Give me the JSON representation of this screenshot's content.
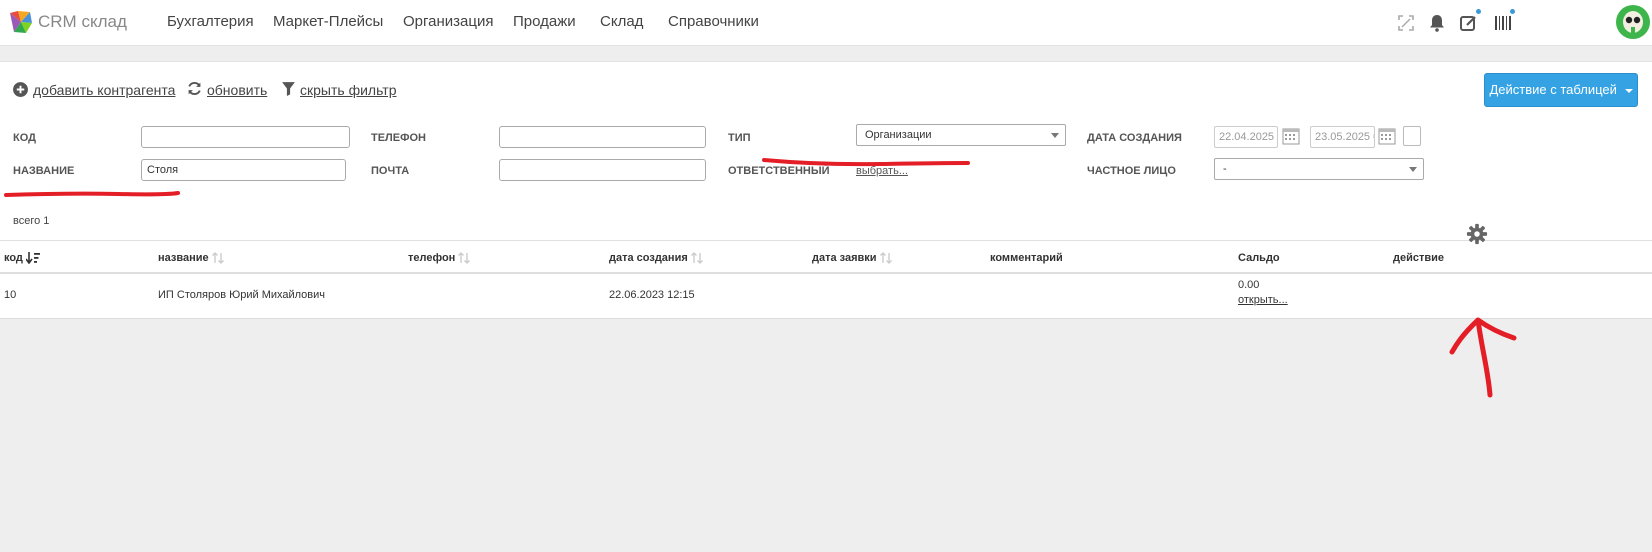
{
  "header": {
    "brand": "CRM склад",
    "nav": [
      "Бухгалтерия",
      "Маркет-Плейсы",
      "Организация",
      "Продажи",
      "Склад",
      "Справочники"
    ]
  },
  "toolbar": {
    "add_label": "добавить контрагента",
    "refresh_label": "обновить",
    "hide_filter_label": "скрыть фильтр",
    "table_action_label": "Действие с таблицей"
  },
  "filters": {
    "code_label": "КОД",
    "code_value": "",
    "name_label": "НАЗВАНИЕ",
    "name_value": "Столя",
    "phone_label": "ТЕЛЕФОН",
    "phone_value": "",
    "email_label": "ПОЧТА",
    "email_value": "",
    "type_label": "ТИП",
    "type_value": "Организации",
    "responsible_label": "ОТВЕТСТВЕННЫЙ",
    "responsible_link": "выбрать...",
    "created_label": "ДАТА СОЗДАНИЯ",
    "date_from": "22.04.2025 0",
    "date_to": "23.05.2025 0",
    "private_label": "ЧАСТНОЕ ЛИЦО",
    "private_value": "-"
  },
  "total_label": "всего 1",
  "table": {
    "columns": [
      "код",
      "название",
      "телефон",
      "дата создания",
      "дата заявки",
      "комментарий",
      "Сальдо",
      "действие"
    ],
    "rows": [
      {
        "code": "10",
        "name": "ИП Столяров Юрий Михайлович",
        "phone": "",
        "created": "22.06.2023 12:15",
        "request_date": "",
        "comment": "",
        "saldo": "0.00",
        "saldo_link": "открыть..."
      }
    ]
  },
  "colors": {
    "accent": "#35a2e3",
    "annotation": "#e41e26",
    "avatar": "#3eb54a"
  }
}
